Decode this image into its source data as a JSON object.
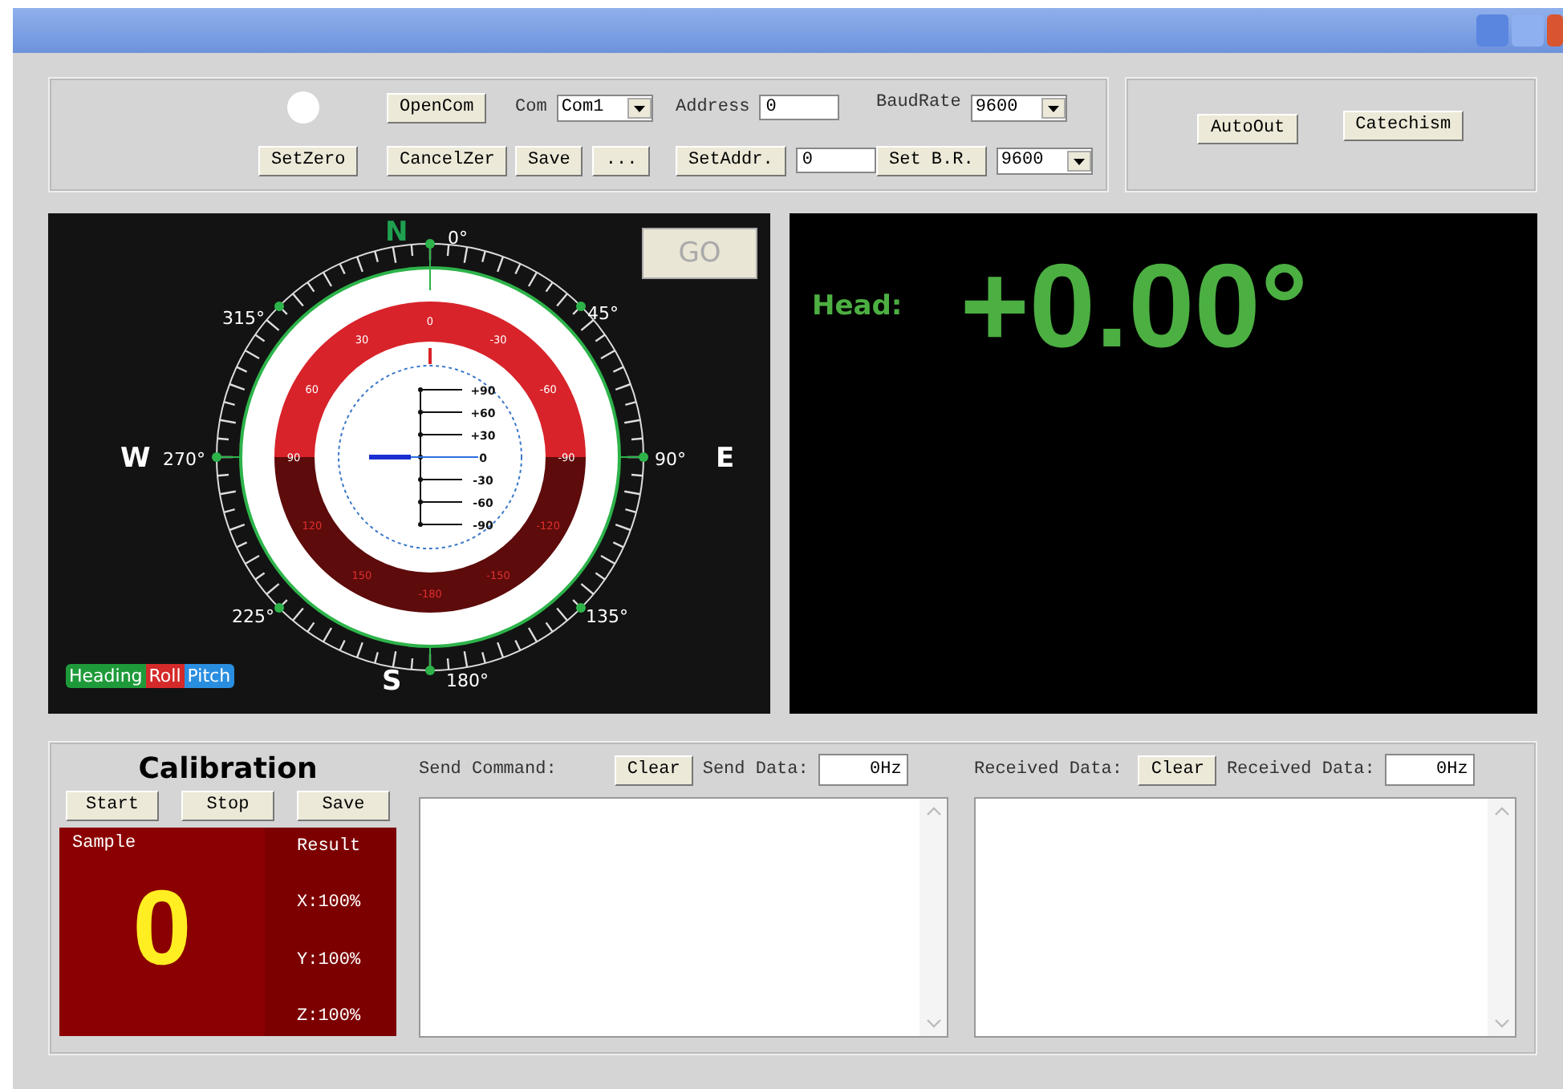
{
  "toolbar": {
    "open_button": "OpenCom",
    "set_zero_button": "SetZero",
    "cancel_zero_button": "CancelZer",
    "com_label": "Com",
    "com_select": "Com1",
    "save_button": "Save",
    "more_button": "...",
    "address_label": "Address",
    "address_field": "0",
    "set_address_button": "SetAddr.",
    "set_address_field": "0",
    "baud_label": "BaudRate",
    "baud_select": "9600",
    "set_baud_button": "Set B.R.",
    "set_baud_select": "9600"
  },
  "actions": [
    "AutoOut",
    "Catechism"
  ],
  "compass": {
    "go_button": "GO",
    "cardinals": [
      "N",
      "E",
      "S",
      "W"
    ],
    "heading_labels": [
      "0°",
      "45°",
      "90°",
      "135°",
      "180°",
      "225°",
      "270°",
      "315°"
    ],
    "roll_labels": [
      "0",
      "-30",
      "-60",
      "-90",
      "-120",
      "-150",
      "-180",
      "150",
      "120",
      "90",
      "60",
      "30"
    ],
    "pitch_labels": [
      "+90",
      "+60",
      "+30",
      "0",
      "-30",
      "-60",
      "-90"
    ],
    "legend": [
      {
        "label": "Heading",
        "color": "#1e9a3a"
      },
      {
        "label": "Roll",
        "color": "#d42a2a"
      },
      {
        "label": "Pitch",
        "color": "#2a8ee0"
      }
    ]
  },
  "head": {
    "label": "Head:",
    "value": "+0.00°"
  },
  "calibration": {
    "title": "Calibration",
    "buttons": [
      "Start",
      "Stop",
      "Save"
    ],
    "sample_label": "Sample",
    "sample_value": "0",
    "result_label": "Result",
    "results": [
      "X:100%",
      "Y:100%",
      "Z:100%"
    ]
  },
  "send": {
    "label": "Send Command:",
    "clear_button": "Clear",
    "rate_label": "Send Data:",
    "rate": "0Hz"
  },
  "receive": {
    "label": "Received Data:",
    "clear_button": "Clear",
    "rate_label": "Received Data:",
    "rate": "0Hz"
  }
}
